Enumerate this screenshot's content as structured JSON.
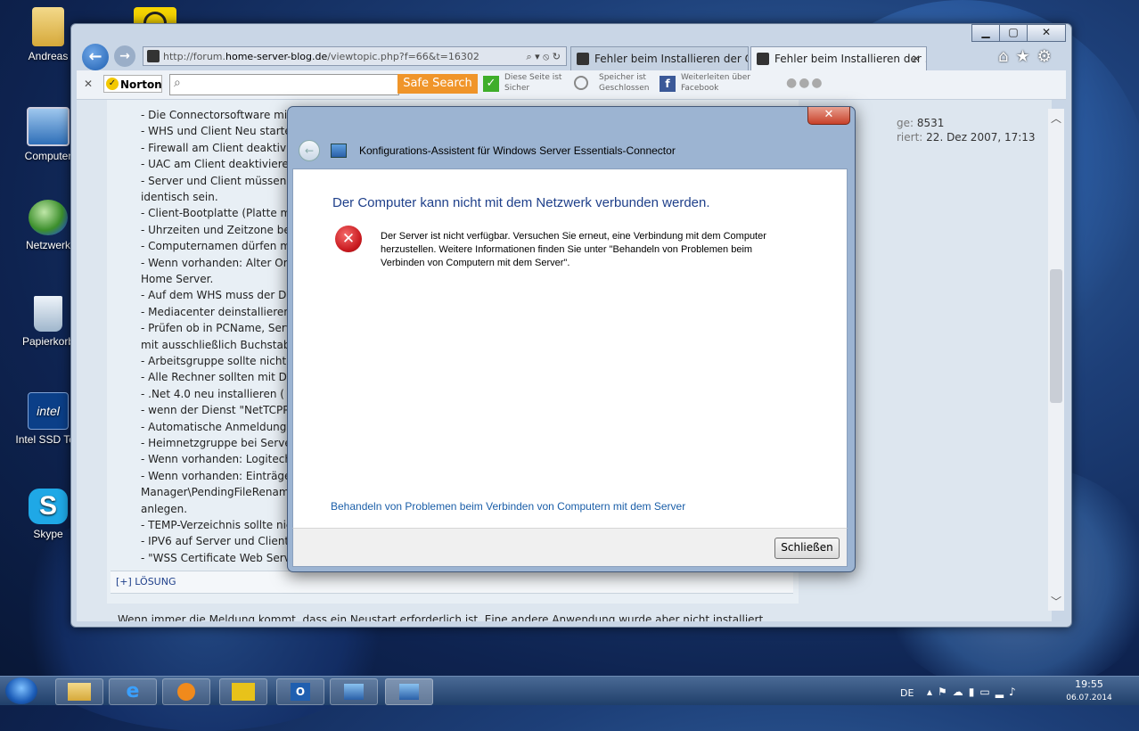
{
  "desktop": {
    "icons": [
      {
        "label": "Andreas"
      },
      {
        "label": "Computer"
      },
      {
        "label": "Netzwerk"
      },
      {
        "label": "Papierkorb"
      },
      {
        "label": "Intel SSD Too"
      },
      {
        "label": "Skype"
      }
    ]
  },
  "browser": {
    "url_prefix": "http://forum.",
    "url_domain": "home-server-blog.de",
    "url_path": "/viewtopic.php?f=66&t=16302",
    "tabs": [
      {
        "label": "Fehler beim Installieren der Co..."
      },
      {
        "label": "Fehler beim Installieren der ..."
      }
    ],
    "toolbar": {
      "norton_label": "Norton",
      "safe_search_label": "Safe Search",
      "site_status_line1": "Diese Seite ist",
      "site_status_line2": "Sicher",
      "storage_line1": "Speicher ist",
      "storage_line2": "Geschlossen",
      "share_line1": "Weiterleiten über",
      "share_line2": "Facebook"
    },
    "profile": {
      "posts_label": "ge:",
      "posts_value": "8531",
      "registered_label": "riert:",
      "registered_value": "22. Dez 2007, 17:13"
    },
    "post_lines": [
      "- Die Connectorsoftware mit dem",
      "- WHS und Client Neu starten.",
      "- Firewall am Client deaktivieren",
      "- UAC am Client deaktivieren.",
      "- Server und Client müssen sich in",
      "identisch sein.",
      "- Client-Bootplatte (Platte mit W",
      "- Uhrzeiten und Zeitzone bei Serv",
      "- Computernamen dürfen maxima",
      "- Wenn vorhanden: Alter Ordner",
      "Home Server.",
      "- Auf dem WHS muss der Dienst 'V",
      "- Mediacenter deinstallieren (Kan",
      "- Prüfen ob in PCName, Servernar",
      "mit ausschließlich Buchstaben un",
      "- Arbeitsgruppe sollte nicht nach",
      "- Alle Rechner sollten mit DHCP e",
      "- .Net 4.0 neu installieren ( http:",
      "- wenn der Dienst \"NetTCPPortSha",
      "- Automatische Anmeldung muss",
      "- Heimnetzgruppe bei Server und",
      "- Wenn vorhanden: Logitech Cam",
      "- Wenn vorhanden: Einträge in de",
      "Manager\\PendingFileRenameOper",
      "anlegen.",
      "- TEMP-Verzeichnis sollte nicht au",
      "- IPV6 auf Server und Client deak",
      "- \"WSS Certificate Web Service\" la"
    ],
    "solution_toggle": "[+] LÖSUNG",
    "bottom_text": "Wenn immer die Meldung kommt, dass ein Neustart erforderlich ist. Eine andere Anwendung wurde aber nicht installiert"
  },
  "dialog": {
    "title": "Konfigurations-Assistent für Windows Server Essentials-Connector",
    "heading": "Der Computer kann nicht mit dem Netzwerk verbunden werden.",
    "message": "Der Server ist nicht verfügbar. Versuchen Sie erneut, eine Verbindung mit dem Computer herzustellen. Weitere Informationen finden Sie unter \"Behandeln von Problemen beim Verbinden von Computern mit dem Server\".",
    "link": "Behandeln von Problemen beim Verbinden von Computern mit dem Server",
    "close_button": "Schließen"
  },
  "taskbar": {
    "language": "DE",
    "time": "19:55",
    "date": "06.07.2014"
  },
  "colors": {
    "dialog_heading": "#1e3f8a",
    "link": "#1a5ea8",
    "error_red": "#c8191e",
    "safe_search_orange": "#f0952a"
  }
}
